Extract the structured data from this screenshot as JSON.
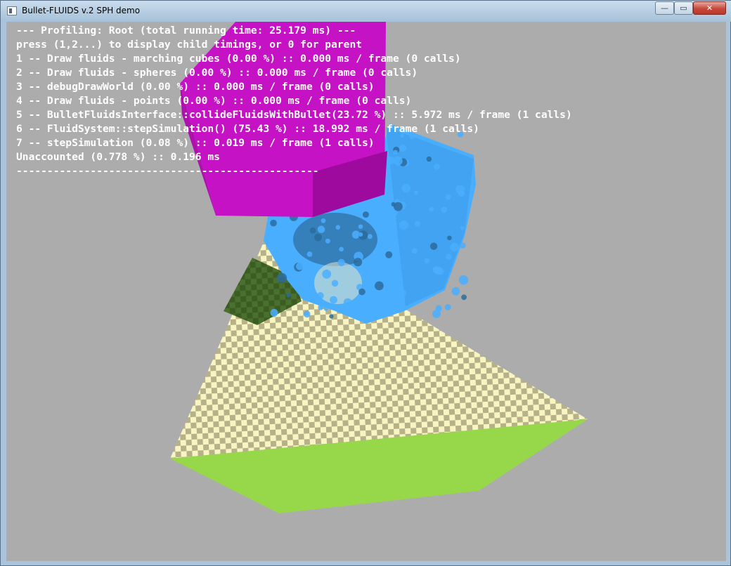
{
  "window": {
    "title": "Bullet-FLUIDS v.2 SPH demo",
    "controls": {
      "minimize_glyph": "—",
      "maximize_glyph": "▭",
      "close_glyph": "✕"
    }
  },
  "profiling": {
    "lines": [
      "--- Profiling: Root (total running time: 25.179 ms) ---",
      "press (1,2...) to display child timings, or 0 for parent",
      "1 -- Draw fluids - marching cubes (0.00 %) :: 0.000 ms / frame (0 calls)",
      "2 -- Draw fluids - spheres (0.00 %) :: 0.000 ms / frame (0 calls)",
      "3 -- debugDrawWorld (0.00 %) :: 0.000 ms / frame (0 calls)",
      "4 -- Draw fluids - points (0.00 %) :: 0.000 ms / frame (0 calls)",
      "5 -- BulletFluidsInterface::collideFluidsWithBullet(23.72 %) :: 5.972 ms / frame (1 calls)",
      "6 -- FluidSystem::stepSimulation() (75.43 %) :: 18.992 ms / frame (1 calls)",
      "7 -- stepSimulation (0.08 %) :: 0.019 ms / frame (1 calls)",
      "Unaccounted (0.778 %) :: 0.196 ms",
      "-------------------------------------------------"
    ]
  },
  "scene": {
    "background": "#acacac",
    "ground_light": "#f8f5c2",
    "ground_dark": "#b7b189",
    "ground_side": "#97d84a",
    "cube_color": "#c412c4",
    "cube_side": "#9e0a9e",
    "fluid_color": "#4aaeff",
    "fluid_shadow": "#2c6b9c",
    "green_patch": "#3c5d22"
  }
}
